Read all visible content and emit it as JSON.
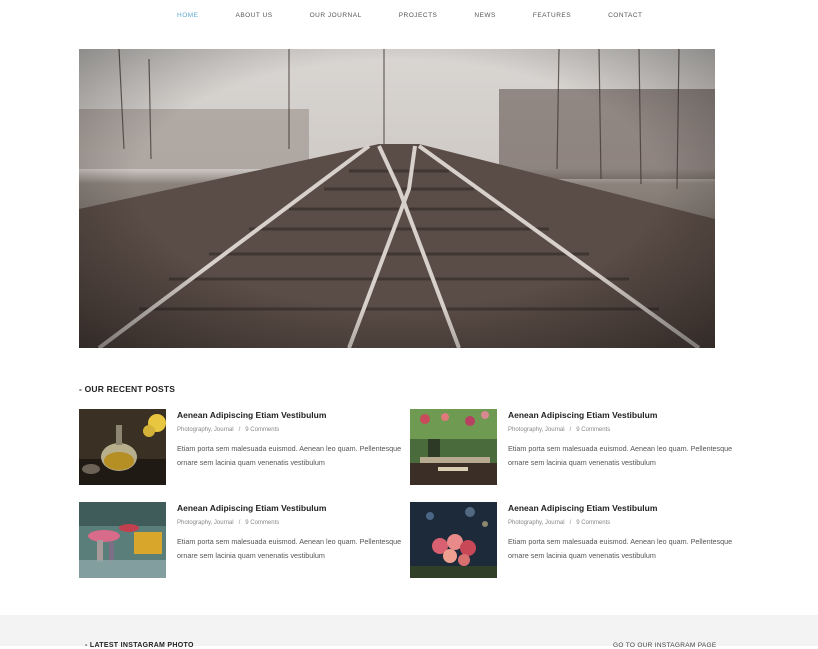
{
  "nav": {
    "items": [
      {
        "label": "HOME",
        "active": true
      },
      {
        "label": "ABOUT US"
      },
      {
        "label": "OUR JOURNAL"
      },
      {
        "label": "PROJECTS"
      },
      {
        "label": "NEWS"
      },
      {
        "label": "FEATURES"
      },
      {
        "label": "CONTACT"
      }
    ],
    "active_color": "#5fa8d3"
  },
  "hero": {
    "image": "railway-tracks-photo"
  },
  "recent_posts": {
    "title": "- OUR RECENT POSTS",
    "posts": [
      {
        "title": "Aenean Adipiscing Etiam Vestibulum",
        "category": "Photography, Journal",
        "separator": "/",
        "comments": "9 Comments",
        "excerpt": "Etiam porta sem malesuada euismod. Aenean leo quam. Pellentesque ornare sem lacinia quam venenatis vestibulum",
        "image": "teapot-photo"
      },
      {
        "title": "Aenean Adipiscing Etiam Vestibulum",
        "category": "Photography, Journal",
        "separator": "/",
        "comments": "9 Comments",
        "excerpt": "Etiam porta sem malesuada euismod. Aenean leo quam. Pellentesque ornare sem lacinia quam venenatis vestibulum",
        "image": "cafe-table-photo"
      },
      {
        "title": "Aenean Adipiscing Etiam Vestibulum",
        "category": "Photography, Journal",
        "separator": "/",
        "comments": "9 Comments",
        "excerpt": "Etiam porta sem malesuada euismod. Aenean leo quam. Pellentesque ornare sem lacinia quam venenatis vestibulum",
        "image": "rainy-street-photo"
      },
      {
        "title": "Aenean Adipiscing Etiam Vestibulum",
        "category": "Photography, Journal",
        "separator": "/",
        "comments": "9 Comments",
        "excerpt": "Etiam porta sem malesuada euismod. Aenean leo quam. Pellentesque ornare sem lacinia quam venenatis vestibulum",
        "image": "roses-bouquet-photo"
      }
    ]
  },
  "footer": {
    "instagram_title": "- LATEST INSTAGRAM PHOTO",
    "instagram_link": "GO TO OUR INSTAGRAM PAGE"
  }
}
